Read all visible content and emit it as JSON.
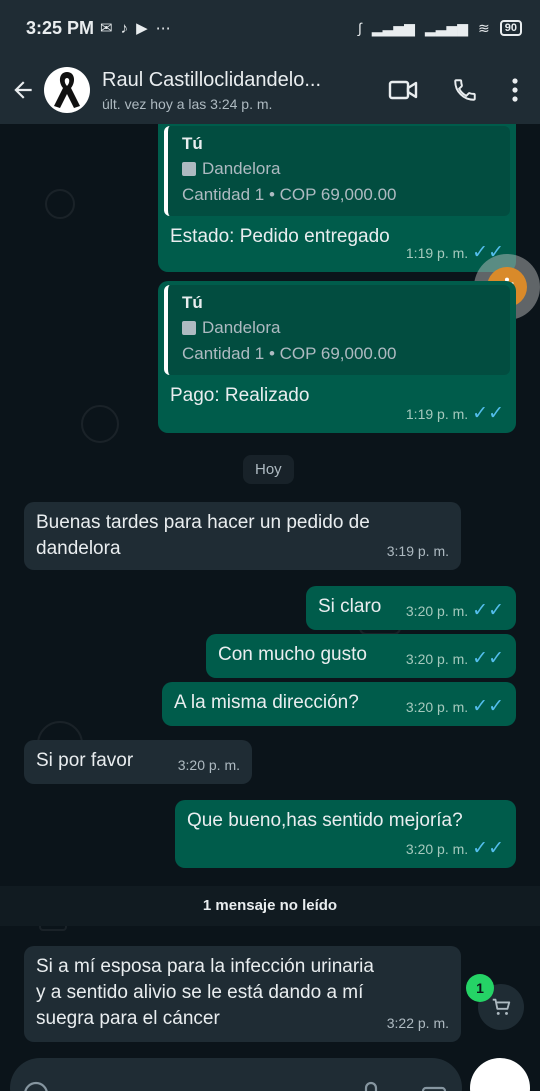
{
  "status_bar": {
    "time": "3:25 PM",
    "battery": "90"
  },
  "header": {
    "contact_name": "Raul Castilloclidandelo...",
    "last_seen": "últ. vez hoy a las 3:24 p. m."
  },
  "messages": [
    {
      "quote_author": "Tú",
      "quote_title": "Dandelora",
      "quote_detail": "Cantidad 1 • COP 69,000.00",
      "text": "Estado: Pedido entregado",
      "time": "1:19 p. m."
    },
    {
      "quote_author": "Tú",
      "quote_title": "Dandelora",
      "quote_detail": "Cantidad 1 • COP 69,000.00",
      "text": "Pago: Realizado",
      "time": "1:19 p. m."
    },
    {
      "text_1": "Buenas tardes para hacer un pedido de",
      "text_2": "dandelora",
      "time": "3:19 p. m."
    },
    {
      "text": "Si claro",
      "time": "3:20 p. m."
    },
    {
      "text": "Con mucho gusto",
      "time": "3:20 p. m."
    },
    {
      "text": "A la misma dirección?",
      "time": "3:20 p. m."
    },
    {
      "text": "Si por favor",
      "time": "3:20 p. m."
    },
    {
      "text": "Que bueno,has sentido mejoría?",
      "time": "3:20 p. m."
    },
    {
      "text_1": "Si a mí esposa para la infección urinaria",
      "text_2": "y  a sentido alivio se le está dando a mí",
      "text_3": "suegra para el cáncer",
      "time": "3:22 p. m."
    }
  ],
  "date_divider": "Hoy",
  "unread_banner": "1 mensaje no leído",
  "cart_badge": "1",
  "colors": {
    "outgoing": "#005c4b",
    "incoming": "#1f2c34",
    "read_ticks": "#53bdeb",
    "badge": "#25d366"
  }
}
